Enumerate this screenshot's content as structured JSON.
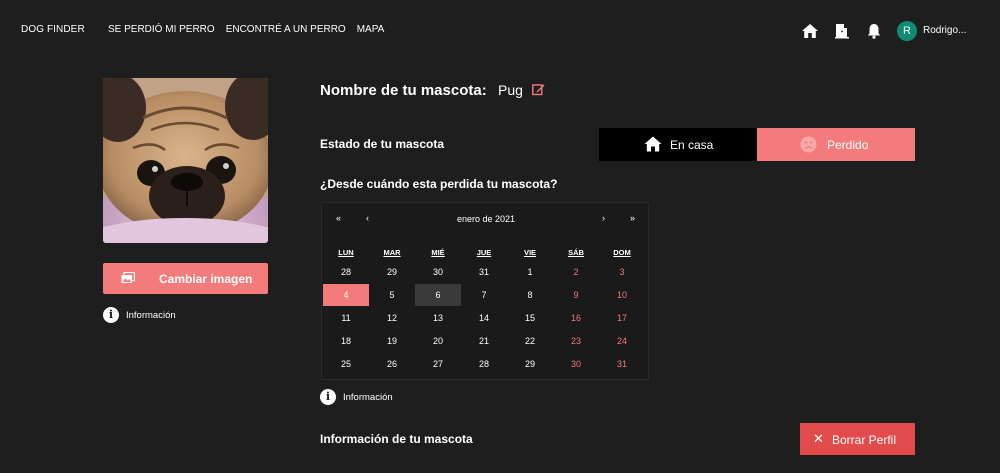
{
  "nav": {
    "brand": "DOG FINDER",
    "links": [
      "SE PERDIÓ MI PERRO",
      "ENCONTRÉ A UN PERRO",
      "MAPA"
    ],
    "icons": [
      "home-icon",
      "door-exit-icon",
      "bell-icon"
    ],
    "avatar_letter": "R",
    "username": "Rodrigo..."
  },
  "sidebar": {
    "change_image_label": "Cambiar imagen",
    "info_label": "Información"
  },
  "pet": {
    "name_label": "Nombre de tu mascota:",
    "name_value": "Pug",
    "status_label": "Estado de tu mascota",
    "status_options": [
      "En casa",
      "Perdido"
    ],
    "status_selected": "Perdido",
    "since_label": "¿Desde cuándo esta perdida tu mascota?",
    "info_label": "Información",
    "info_title": "Información de tu mascota",
    "delete_label": "Borrar Perfil"
  },
  "calendar": {
    "prev_year": "«",
    "prev_month": "‹",
    "title": "enero de 2021",
    "next_month": "›",
    "next_year": "»",
    "weekdays": [
      "LUN",
      "MAR",
      "MIÉ",
      "JUE",
      "VIE",
      "SÁB",
      "DOM"
    ],
    "weeks": [
      [
        "28",
        "29",
        "30",
        "31",
        "1",
        "2",
        "3"
      ],
      [
        "4",
        "5",
        "6",
        "7",
        "8",
        "9",
        "10"
      ],
      [
        "11",
        "12",
        "13",
        "14",
        "15",
        "16",
        "17"
      ],
      [
        "18",
        "19",
        "20",
        "21",
        "22",
        "23",
        "24"
      ],
      [
        "25",
        "26",
        "27",
        "28",
        "29",
        "30",
        "31"
      ]
    ],
    "selected_day": "4",
    "today_day": "6"
  },
  "colors": {
    "background": "#1e1e1e",
    "accent": "#f47b7b",
    "danger": "#e14b4b",
    "avatar": "#0f8a73"
  }
}
